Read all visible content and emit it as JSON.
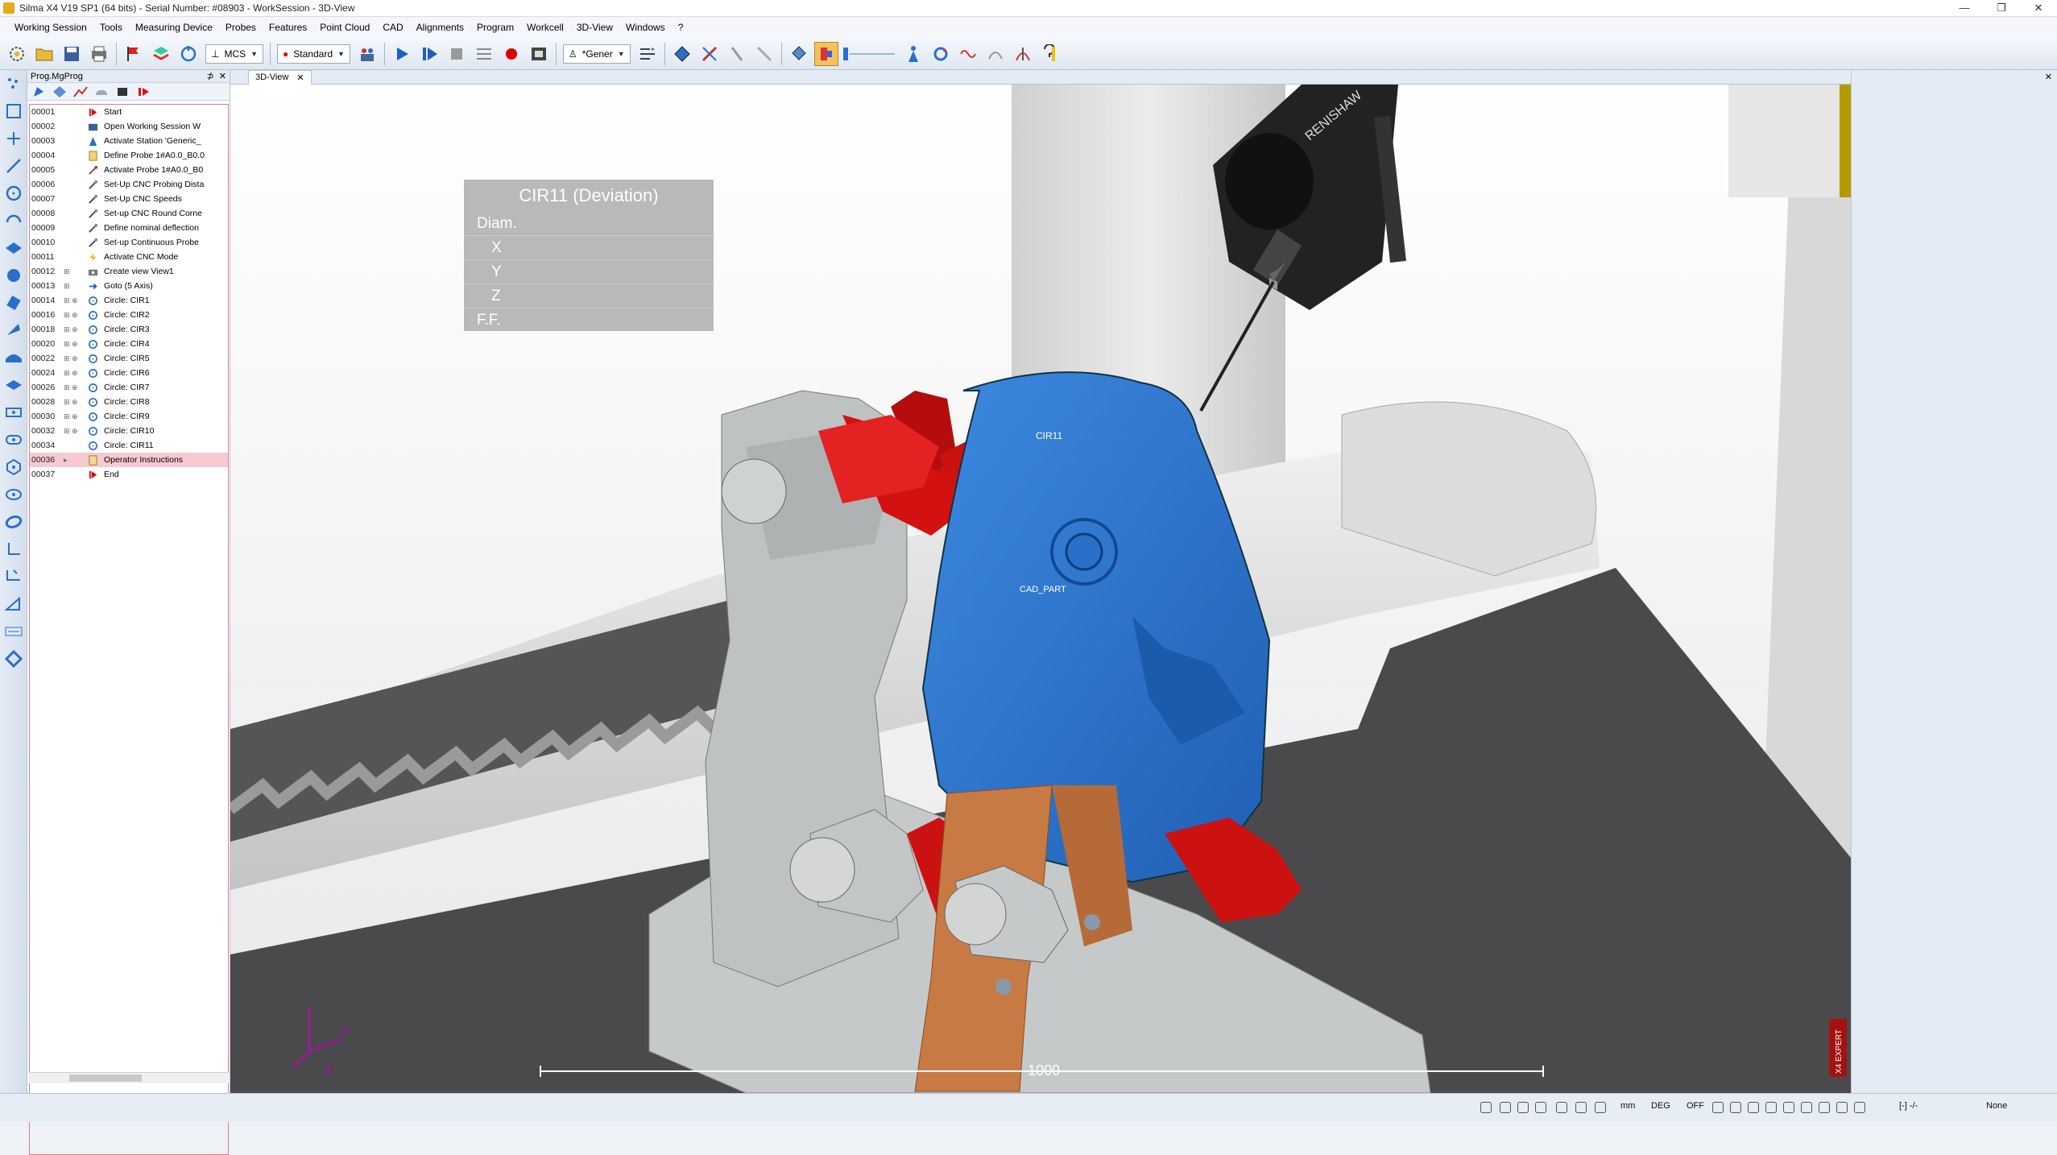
{
  "window": {
    "title": "Silma X4 V19 SP1 (64 bits) - Serial Number: #08903 - WorkSession - 3D-View"
  },
  "menu": [
    "Working Session",
    "Tools",
    "Measuring Device",
    "Probes",
    "Features",
    "Point Cloud",
    "CAD",
    "Alignments",
    "Program",
    "Workcell",
    "3D-View",
    "Windows",
    "?"
  ],
  "toolbar": {
    "coord_system": "MCS",
    "probe_mode": "Standard",
    "view_mode": "*Gener"
  },
  "panel": {
    "title": "Prog.MgProg",
    "pin": "⊅",
    "close": "✕"
  },
  "tree": [
    {
      "line": "00001",
      "label": "Start",
      "icon": "start-flag-icon"
    },
    {
      "line": "00002",
      "label": "Open Working Session W",
      "icon": "open-session-icon"
    },
    {
      "line": "00003",
      "label": "Activate Station 'Generic_",
      "icon": "station-icon"
    },
    {
      "line": "00004",
      "label": "Define Probe 1#A0.0_B0.0",
      "icon": "probe-define-icon"
    },
    {
      "line": "00005",
      "label": "Activate Probe 1#A0.0_B0",
      "icon": "probe-activate-icon"
    },
    {
      "line": "00006",
      "label": "Set-Up CNC Probing Dista",
      "icon": "cnc-setup-icon"
    },
    {
      "line": "00007",
      "label": "Set-Up CNC Speeds",
      "icon": "cnc-setup-icon"
    },
    {
      "line": "00008",
      "label": "Set-up CNC Round Corne",
      "icon": "cnc-setup-icon"
    },
    {
      "line": "00009",
      "label": "Define nominal deflection",
      "icon": "cnc-setup-icon"
    },
    {
      "line": "00010",
      "label": "Set-up Continuous Probe",
      "icon": "cnc-setup-icon"
    },
    {
      "line": "00011",
      "label": "Activate CNC Mode",
      "icon": "lightning-icon"
    },
    {
      "line": "00012",
      "label": "Create view View1",
      "icon": "camera-icon"
    },
    {
      "line": "00013",
      "label": "Goto (5 Axis)",
      "icon": "goto-icon"
    },
    {
      "line": "00014",
      "label": "Circle: CIR1",
      "icon": "circle-feature-icon"
    },
    {
      "line": "00016",
      "label": "Circle: CIR2",
      "icon": "circle-feature-icon"
    },
    {
      "line": "00018",
      "label": "Circle: CIR3",
      "icon": "circle-feature-icon"
    },
    {
      "line": "00020",
      "label": "Circle: CIR4",
      "icon": "circle-feature-icon"
    },
    {
      "line": "00022",
      "label": "Circle: CIR5",
      "icon": "circle-feature-icon"
    },
    {
      "line": "00024",
      "label": "Circle: CIR6",
      "icon": "circle-feature-icon"
    },
    {
      "line": "00026",
      "label": "Circle: CIR7",
      "icon": "circle-feature-icon"
    },
    {
      "line": "00028",
      "label": "Circle: CIR8",
      "icon": "circle-feature-icon"
    },
    {
      "line": "00030",
      "label": "Circle: CIR9",
      "icon": "circle-feature-icon"
    },
    {
      "line": "00032",
      "label": "Circle: CIR10",
      "icon": "circle-feature-icon"
    },
    {
      "line": "00034",
      "label": "Circle: CIR11",
      "icon": "circle-feature-icon"
    },
    {
      "line": "00036",
      "label": "Operator Instructions",
      "icon": "operator-icon",
      "selected": true
    },
    {
      "line": "00037",
      "label": "End",
      "icon": "end-flag-icon"
    }
  ],
  "view": {
    "tab_label": "3D-View",
    "tab_close": "✕",
    "caret": "▼",
    "right_close": "✕",
    "info": {
      "title": "CIR11 (Deviation)",
      "rows": [
        "Diam.",
        "X",
        "Y",
        "Z",
        "F.F."
      ]
    },
    "labels": {
      "feature": "CIR11",
      "part": "CAD_PART",
      "scale": "1000",
      "axis_y": "Y",
      "axis_x": "X",
      "probe_brand": "RENISHAW",
      "brand": "X4 EXPERT"
    }
  },
  "status": {
    "unit": "mm",
    "angle": "DEG",
    "state": "OFF",
    "scale": "[-] -/-",
    "none": "None"
  },
  "window_buttons": [
    "—",
    "❐",
    "✕"
  ],
  "colors": {
    "part": "#2f78d0",
    "clamp": "#cc1111",
    "fixture": "#c9cccc",
    "bracket": "#c77a44",
    "table": "#4a4a4c"
  }
}
